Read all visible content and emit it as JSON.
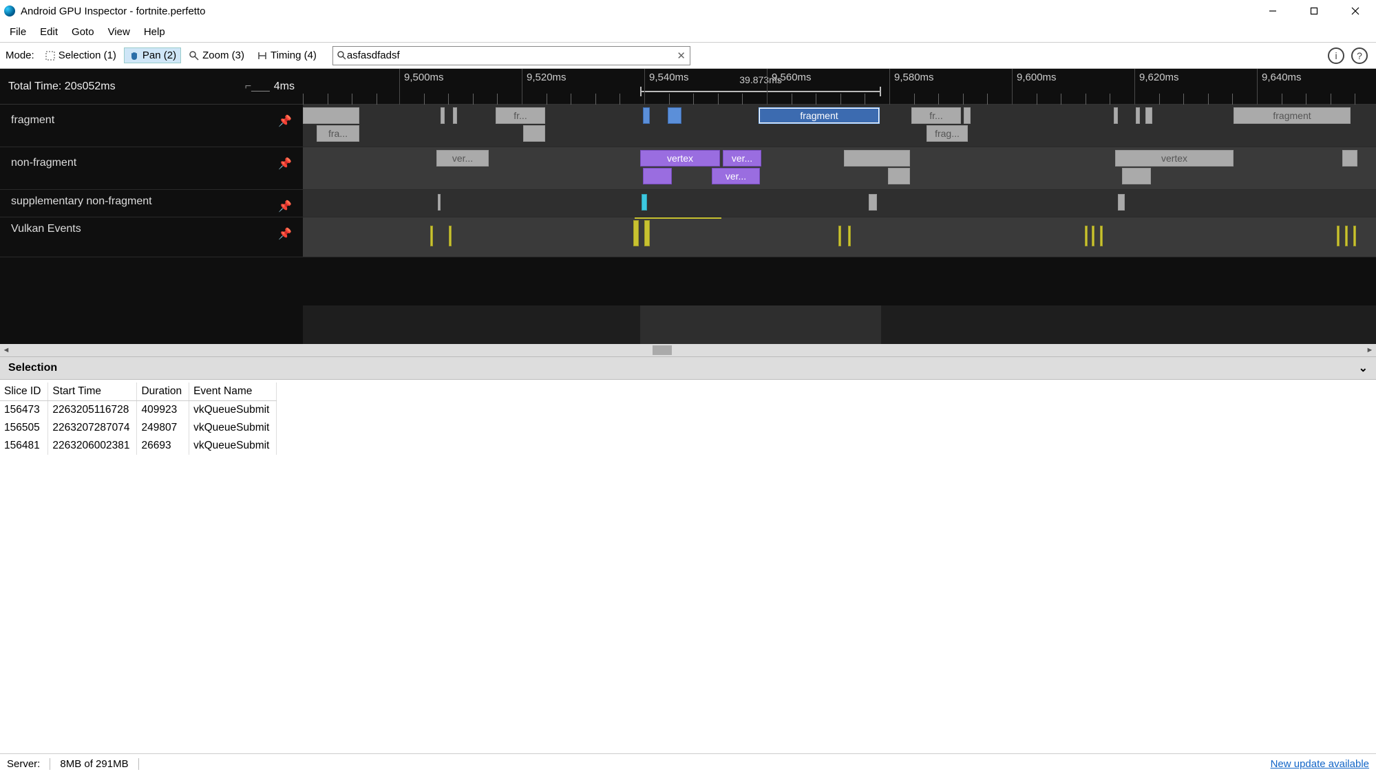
{
  "window": {
    "title": "Android GPU Inspector - fortnite.perfetto"
  },
  "menu": [
    "File",
    "Edit",
    "Goto",
    "View",
    "Help"
  ],
  "toolbar": {
    "mode_label": "Mode:",
    "modes": [
      {
        "label": "Selection (1)"
      },
      {
        "label": "Pan (2)",
        "active": true
      },
      {
        "label": "Zoom (3)"
      },
      {
        "label": "Timing (4)"
      }
    ],
    "search_value": "asfasdfadsf"
  },
  "timeline": {
    "total_label": "Total Time: 20s052ms",
    "scale_label": "4ms",
    "ticks": [
      "9,500ms",
      "9,520ms",
      "9,540ms",
      "9,560ms",
      "9,580ms",
      "9,600ms",
      "9,620ms",
      "9,640ms"
    ],
    "range_label": "39.873ms",
    "tracks": [
      {
        "name": "fragment"
      },
      {
        "name": "non-fragment"
      },
      {
        "name": "supplementary non-fragment"
      },
      {
        "name": "Vulkan Events"
      }
    ],
    "slice_labels": {
      "fragment": "fragment",
      "fra": "fra...",
      "fr": "fr...",
      "frag": "frag...",
      "vertex": "vertex",
      "ver": "ver..."
    }
  },
  "selection": {
    "title": "Selection",
    "headers": [
      "Slice ID",
      "Start Time",
      "Duration",
      "Event Name"
    ],
    "rows": [
      [
        "156473",
        "2263205116728",
        "409923",
        "vkQueueSubmit"
      ],
      [
        "156505",
        "2263207287074",
        "249807",
        "vkQueueSubmit"
      ],
      [
        "156481",
        "2263206002381",
        "26693",
        "vkQueueSubmit"
      ]
    ]
  },
  "status": {
    "server": "Server:",
    "memory": "8MB of 291MB",
    "update": "New update available"
  }
}
